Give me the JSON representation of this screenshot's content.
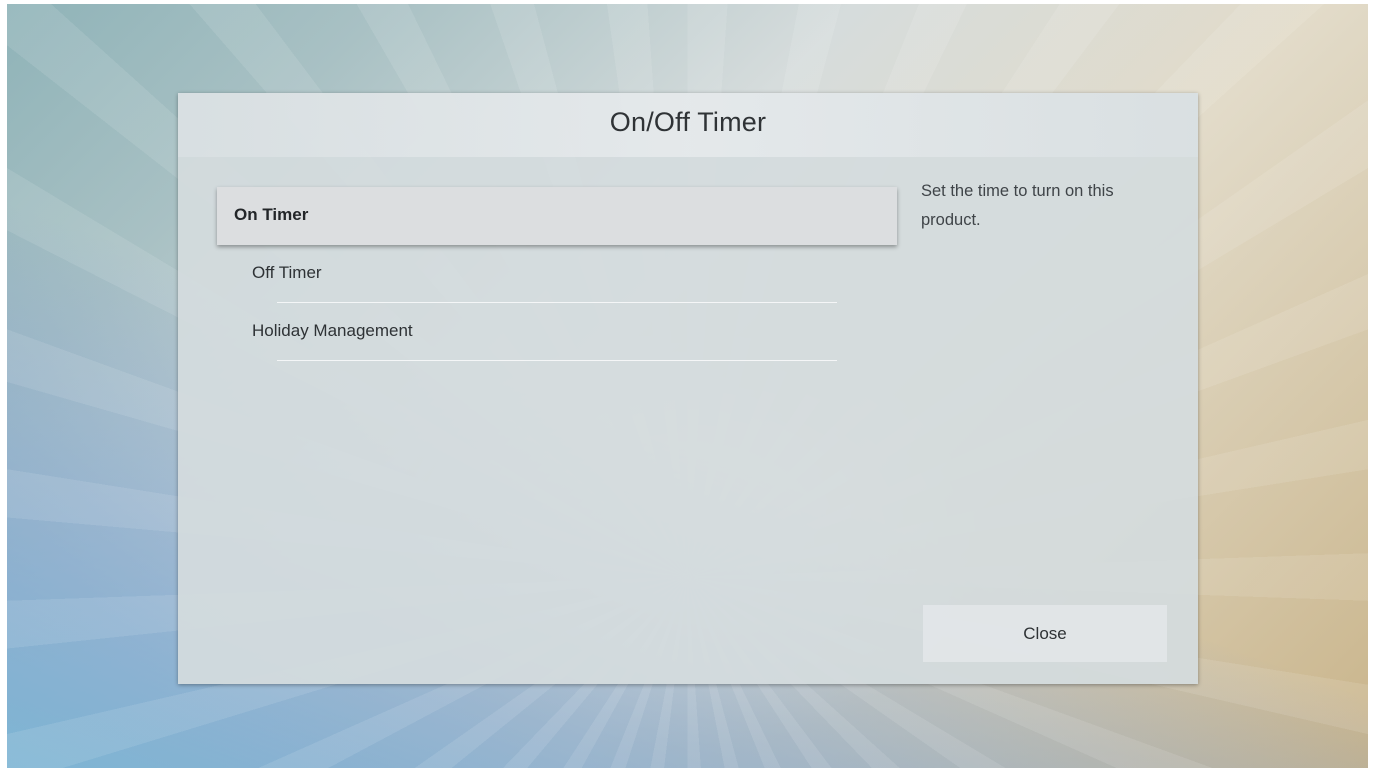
{
  "dialog": {
    "title": "On/Off Timer",
    "menu_items": [
      {
        "label": "On Timer",
        "selected": true
      },
      {
        "label": "Off Timer",
        "selected": false
      },
      {
        "label": "Holiday Management",
        "selected": false
      }
    ],
    "description": "Set the time to turn on this product.",
    "close_label": "Close"
  },
  "colors": {
    "selected_item_bg": "#dcdee0",
    "dialog_bg": "#d4dbde",
    "text": "#2e3235"
  }
}
